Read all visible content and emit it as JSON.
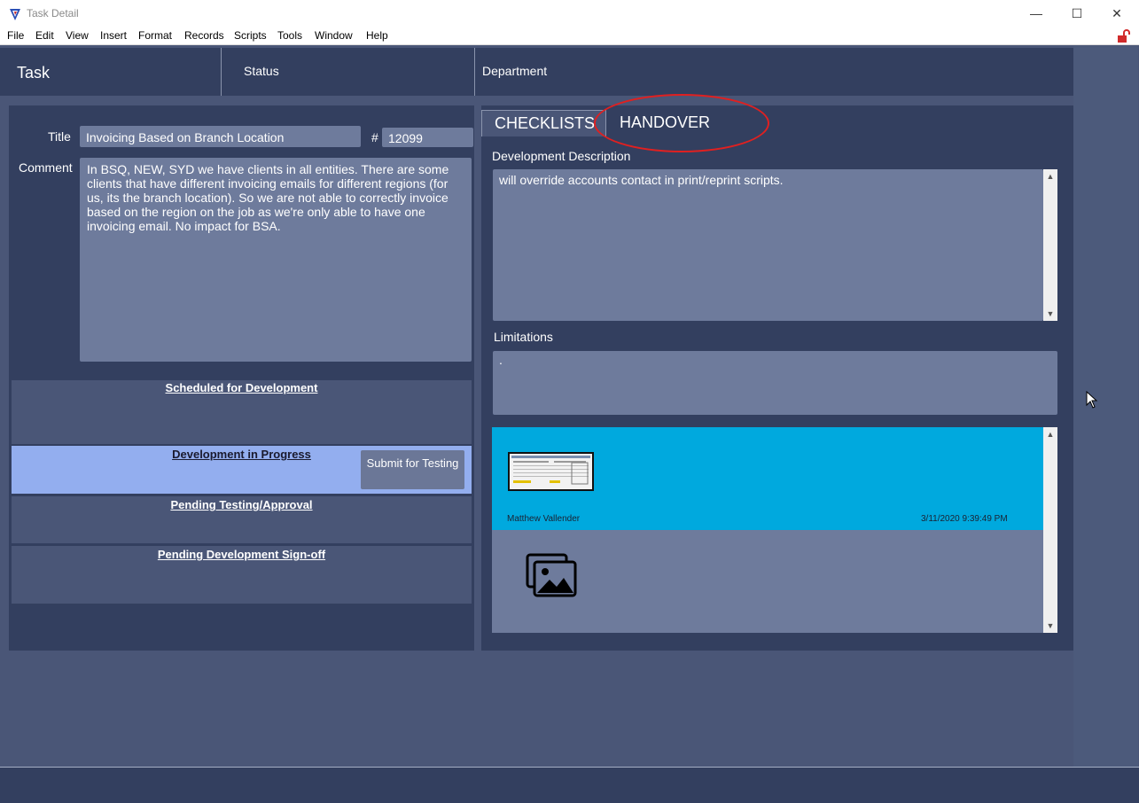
{
  "window": {
    "title": "Task Detail",
    "controls": {
      "minimize": "—",
      "maximize": "☐",
      "close": "✕"
    }
  },
  "menu": [
    "File",
    "Edit",
    "View",
    "Insert",
    "Format",
    "Records",
    "Scripts",
    "Tools",
    "Window",
    "Help"
  ],
  "header": {
    "task": "Task",
    "status": "Status",
    "department": "Department"
  },
  "task": {
    "title_label": "Title",
    "title_value": "Invoicing Based on Branch Location",
    "number_label": "#",
    "number_value": "12099",
    "comment_label": "Comment",
    "comment_value": "In BSQ, NEW, SYD we have clients in all entities. There are some clients that have different invoicing emails for different regions (for us, its the branch location). So we are not able to correctly invoice based on the region on the job as we're only able to have one invoicing email. No impact for BSA."
  },
  "workflow": [
    {
      "label": "Scheduled for Development",
      "active": false
    },
    {
      "label": "Development in Progress",
      "active": true
    },
    {
      "label": "Pending Testing/Approval",
      "active": false
    },
    {
      "label": "Pending Development Sign-off",
      "active": false
    }
  ],
  "submit_button": "Submit for Testing",
  "tabs": {
    "checklists": "CHECKLISTS",
    "handover": "HANDOVER"
  },
  "handover": {
    "dev_desc_label": "Development Description",
    "dev_desc_value": "will override accounts contact in print/reprint scripts.",
    "limitations_label": "Limitations",
    "limitations_value": "."
  },
  "attachments": [
    {
      "user": "Matthew Vallender",
      "date": "3/11/2020 9:39:49 PM"
    }
  ],
  "colors": {
    "accent": "#00a9de",
    "panel": "#333f5f",
    "active_row": "#93aeef",
    "annotation": "#e02020"
  },
  "icons": [
    "app-icon",
    "lock-icon",
    "image-placeholder-icon",
    "scroll-up-icon",
    "scroll-down-icon"
  ]
}
